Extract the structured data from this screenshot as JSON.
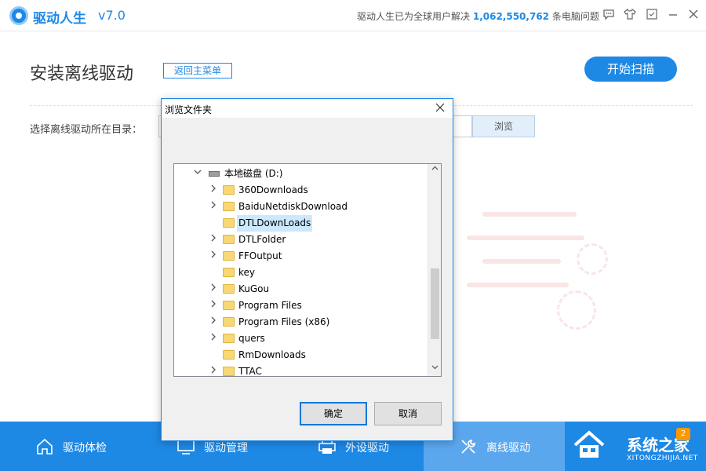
{
  "app": {
    "name": "驱动人生",
    "version": "v7.0",
    "stat_prefix": "驱动人生已为全球用户解决",
    "stat_count": "1,062,550,762",
    "stat_suffix": "条电脑问题",
    "accent_color": "#1e88e5"
  },
  "titlebar_icons": [
    "chat-icon",
    "shirt-icon",
    "pin-icon",
    "minimize-icon",
    "close-icon"
  ],
  "main": {
    "title": "安装离线驱动",
    "back_label": "返回主菜单",
    "scan_label": "开始扫描",
    "dir_label": "选择离线驱动所在目录：",
    "dir_value": "",
    "browse_label": "浏览"
  },
  "dialog": {
    "title": "浏览文件夹",
    "close_glyph": "✕",
    "drive": "本地磁盘 (D:)",
    "folders": [
      {
        "name": "360Downloads",
        "expandable": true,
        "selected": false
      },
      {
        "name": "BaiduNetdiskDownload",
        "expandable": true,
        "selected": false
      },
      {
        "name": "DTLDownLoads",
        "expandable": false,
        "selected": true
      },
      {
        "name": "DTLFolder",
        "expandable": true,
        "selected": false
      },
      {
        "name": "FFOutput",
        "expandable": true,
        "selected": false
      },
      {
        "name": "key",
        "expandable": false,
        "selected": false
      },
      {
        "name": "KuGou",
        "expandable": true,
        "selected": false
      },
      {
        "name": "Program Files",
        "expandable": true,
        "selected": false
      },
      {
        "name": "Program Files (x86)",
        "expandable": true,
        "selected": false
      },
      {
        "name": "quers",
        "expandable": true,
        "selected": false
      },
      {
        "name": "RmDownloads",
        "expandable": false,
        "selected": false
      },
      {
        "name": "TTAC",
        "expandable": true,
        "selected": false
      }
    ],
    "ok_label": "确定",
    "cancel_label": "取消"
  },
  "bottom_nav": [
    {
      "label": "驱动体检",
      "icon": "home-icon",
      "active": false
    },
    {
      "label": "驱动管理",
      "icon": "monitor-icon",
      "active": false
    },
    {
      "label": "外设驱动",
      "icon": "printer-icon",
      "active": false
    },
    {
      "label": "离线驱动",
      "icon": "tools-icon",
      "active": true
    }
  ],
  "badge": "2",
  "watermark": {
    "text": "系统之家",
    "url": "XITONGZHIJIA.NET"
  }
}
